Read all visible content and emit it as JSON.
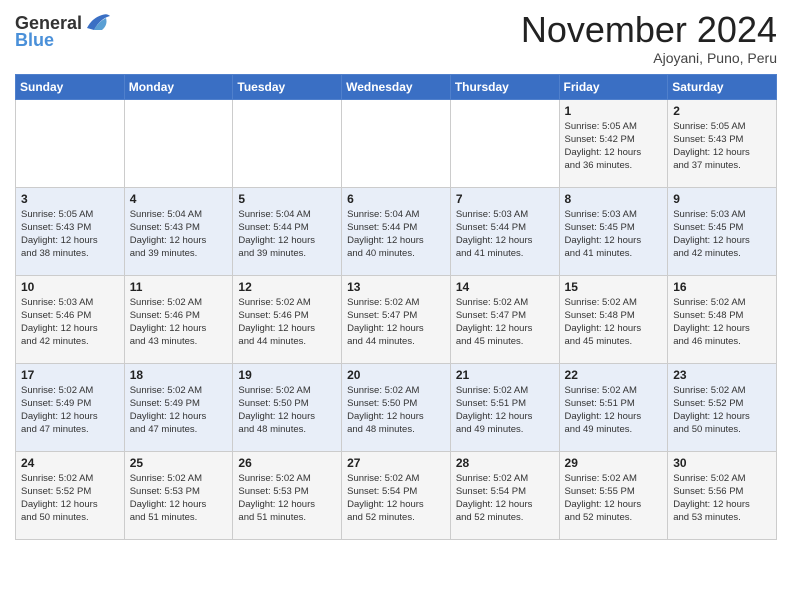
{
  "header": {
    "logo_general": "General",
    "logo_blue": "Blue",
    "title": "November 2024",
    "location": "Ajoyani, Puno, Peru"
  },
  "weekdays": [
    "Sunday",
    "Monday",
    "Tuesday",
    "Wednesday",
    "Thursday",
    "Friday",
    "Saturday"
  ],
  "weeks": [
    [
      {
        "day": "",
        "info": ""
      },
      {
        "day": "",
        "info": ""
      },
      {
        "day": "",
        "info": ""
      },
      {
        "day": "",
        "info": ""
      },
      {
        "day": "",
        "info": ""
      },
      {
        "day": "1",
        "info": "Sunrise: 5:05 AM\nSunset: 5:42 PM\nDaylight: 12 hours\nand 36 minutes."
      },
      {
        "day": "2",
        "info": "Sunrise: 5:05 AM\nSunset: 5:43 PM\nDaylight: 12 hours\nand 37 minutes."
      }
    ],
    [
      {
        "day": "3",
        "info": "Sunrise: 5:05 AM\nSunset: 5:43 PM\nDaylight: 12 hours\nand 38 minutes."
      },
      {
        "day": "4",
        "info": "Sunrise: 5:04 AM\nSunset: 5:43 PM\nDaylight: 12 hours\nand 39 minutes."
      },
      {
        "day": "5",
        "info": "Sunrise: 5:04 AM\nSunset: 5:44 PM\nDaylight: 12 hours\nand 39 minutes."
      },
      {
        "day": "6",
        "info": "Sunrise: 5:04 AM\nSunset: 5:44 PM\nDaylight: 12 hours\nand 40 minutes."
      },
      {
        "day": "7",
        "info": "Sunrise: 5:03 AM\nSunset: 5:44 PM\nDaylight: 12 hours\nand 41 minutes."
      },
      {
        "day": "8",
        "info": "Sunrise: 5:03 AM\nSunset: 5:45 PM\nDaylight: 12 hours\nand 41 minutes."
      },
      {
        "day": "9",
        "info": "Sunrise: 5:03 AM\nSunset: 5:45 PM\nDaylight: 12 hours\nand 42 minutes."
      }
    ],
    [
      {
        "day": "10",
        "info": "Sunrise: 5:03 AM\nSunset: 5:46 PM\nDaylight: 12 hours\nand 42 minutes."
      },
      {
        "day": "11",
        "info": "Sunrise: 5:02 AM\nSunset: 5:46 PM\nDaylight: 12 hours\nand 43 minutes."
      },
      {
        "day": "12",
        "info": "Sunrise: 5:02 AM\nSunset: 5:46 PM\nDaylight: 12 hours\nand 44 minutes."
      },
      {
        "day": "13",
        "info": "Sunrise: 5:02 AM\nSunset: 5:47 PM\nDaylight: 12 hours\nand 44 minutes."
      },
      {
        "day": "14",
        "info": "Sunrise: 5:02 AM\nSunset: 5:47 PM\nDaylight: 12 hours\nand 45 minutes."
      },
      {
        "day": "15",
        "info": "Sunrise: 5:02 AM\nSunset: 5:48 PM\nDaylight: 12 hours\nand 45 minutes."
      },
      {
        "day": "16",
        "info": "Sunrise: 5:02 AM\nSunset: 5:48 PM\nDaylight: 12 hours\nand 46 minutes."
      }
    ],
    [
      {
        "day": "17",
        "info": "Sunrise: 5:02 AM\nSunset: 5:49 PM\nDaylight: 12 hours\nand 47 minutes."
      },
      {
        "day": "18",
        "info": "Sunrise: 5:02 AM\nSunset: 5:49 PM\nDaylight: 12 hours\nand 47 minutes."
      },
      {
        "day": "19",
        "info": "Sunrise: 5:02 AM\nSunset: 5:50 PM\nDaylight: 12 hours\nand 48 minutes."
      },
      {
        "day": "20",
        "info": "Sunrise: 5:02 AM\nSunset: 5:50 PM\nDaylight: 12 hours\nand 48 minutes."
      },
      {
        "day": "21",
        "info": "Sunrise: 5:02 AM\nSunset: 5:51 PM\nDaylight: 12 hours\nand 49 minutes."
      },
      {
        "day": "22",
        "info": "Sunrise: 5:02 AM\nSunset: 5:51 PM\nDaylight: 12 hours\nand 49 minutes."
      },
      {
        "day": "23",
        "info": "Sunrise: 5:02 AM\nSunset: 5:52 PM\nDaylight: 12 hours\nand 50 minutes."
      }
    ],
    [
      {
        "day": "24",
        "info": "Sunrise: 5:02 AM\nSunset: 5:52 PM\nDaylight: 12 hours\nand 50 minutes."
      },
      {
        "day": "25",
        "info": "Sunrise: 5:02 AM\nSunset: 5:53 PM\nDaylight: 12 hours\nand 51 minutes."
      },
      {
        "day": "26",
        "info": "Sunrise: 5:02 AM\nSunset: 5:53 PM\nDaylight: 12 hours\nand 51 minutes."
      },
      {
        "day": "27",
        "info": "Sunrise: 5:02 AM\nSunset: 5:54 PM\nDaylight: 12 hours\nand 52 minutes."
      },
      {
        "day": "28",
        "info": "Sunrise: 5:02 AM\nSunset: 5:54 PM\nDaylight: 12 hours\nand 52 minutes."
      },
      {
        "day": "29",
        "info": "Sunrise: 5:02 AM\nSunset: 5:55 PM\nDaylight: 12 hours\nand 52 minutes."
      },
      {
        "day": "30",
        "info": "Sunrise: 5:02 AM\nSunset: 5:56 PM\nDaylight: 12 hours\nand 53 minutes."
      }
    ]
  ]
}
